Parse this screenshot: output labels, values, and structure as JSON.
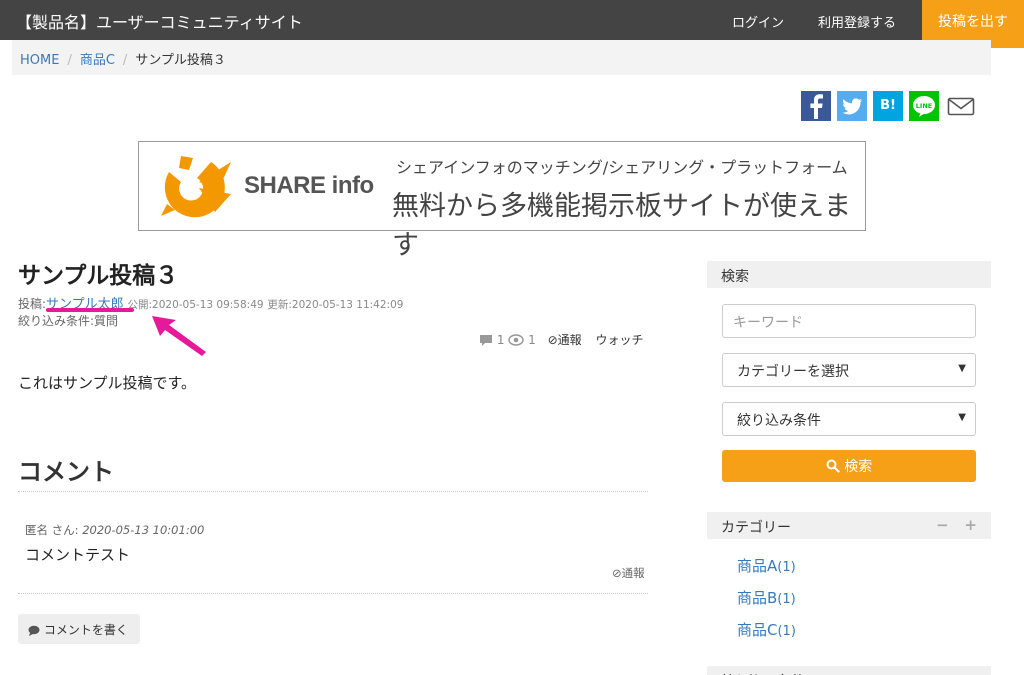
{
  "navbar": {
    "brand": "【製品名】ユーザーコミュニティサイト",
    "login": "ログイン",
    "register": "利用登録する",
    "post_button": "投稿を出す"
  },
  "breadcrumb": {
    "home": "HOME",
    "category": "商品C",
    "current": "サンプル投稿３"
  },
  "share": {
    "hatena_label": "B!",
    "line_label": "LINE"
  },
  "banner": {
    "logo_text": "SHARE info",
    "line1": "シェアインフォのマッチング/シェアリング・プラットフォーム",
    "line2": "無料から多機能掲示板サイトが使えます"
  },
  "post": {
    "title": "サンプル投稿３",
    "author_prefix": "投稿:",
    "author": "サンプル太郎",
    "published": "公開:2020-05-13 09:58:49",
    "updated": "更新:2020-05-13 11:42:09",
    "filter": "絞り込み条件:質問",
    "comment_count": "1",
    "view_count": "1",
    "report": "通報",
    "watch": "ウォッチ",
    "body": "これはサンプル投稿です。"
  },
  "comments": {
    "heading": "コメント",
    "items": [
      {
        "author": "匿名 さん",
        "time": "2020-05-13 10:01:00",
        "text": "コメントテスト",
        "report": "通報"
      }
    ],
    "write_button": "コメントを書く"
  },
  "sidebar": {
    "search_heading": "検索",
    "keyword_placeholder": "キーワード",
    "category_select": "カテゴリーを選択",
    "filter_select": "絞り込み条件",
    "search_button": "検索",
    "category_heading": "カテゴリー",
    "categories": [
      {
        "name": "商品A",
        "count": "(1)"
      },
      {
        "name": "商品B",
        "count": "(1)"
      },
      {
        "name": "商品C",
        "count": "(1)"
      }
    ],
    "filter_heading": "絞り込み条件"
  },
  "colors": {
    "navbar_bg": "#444444",
    "accent_orange": "#f5a016",
    "link_blue": "#3a79b8",
    "annotation_magenta": "#e6199b"
  }
}
